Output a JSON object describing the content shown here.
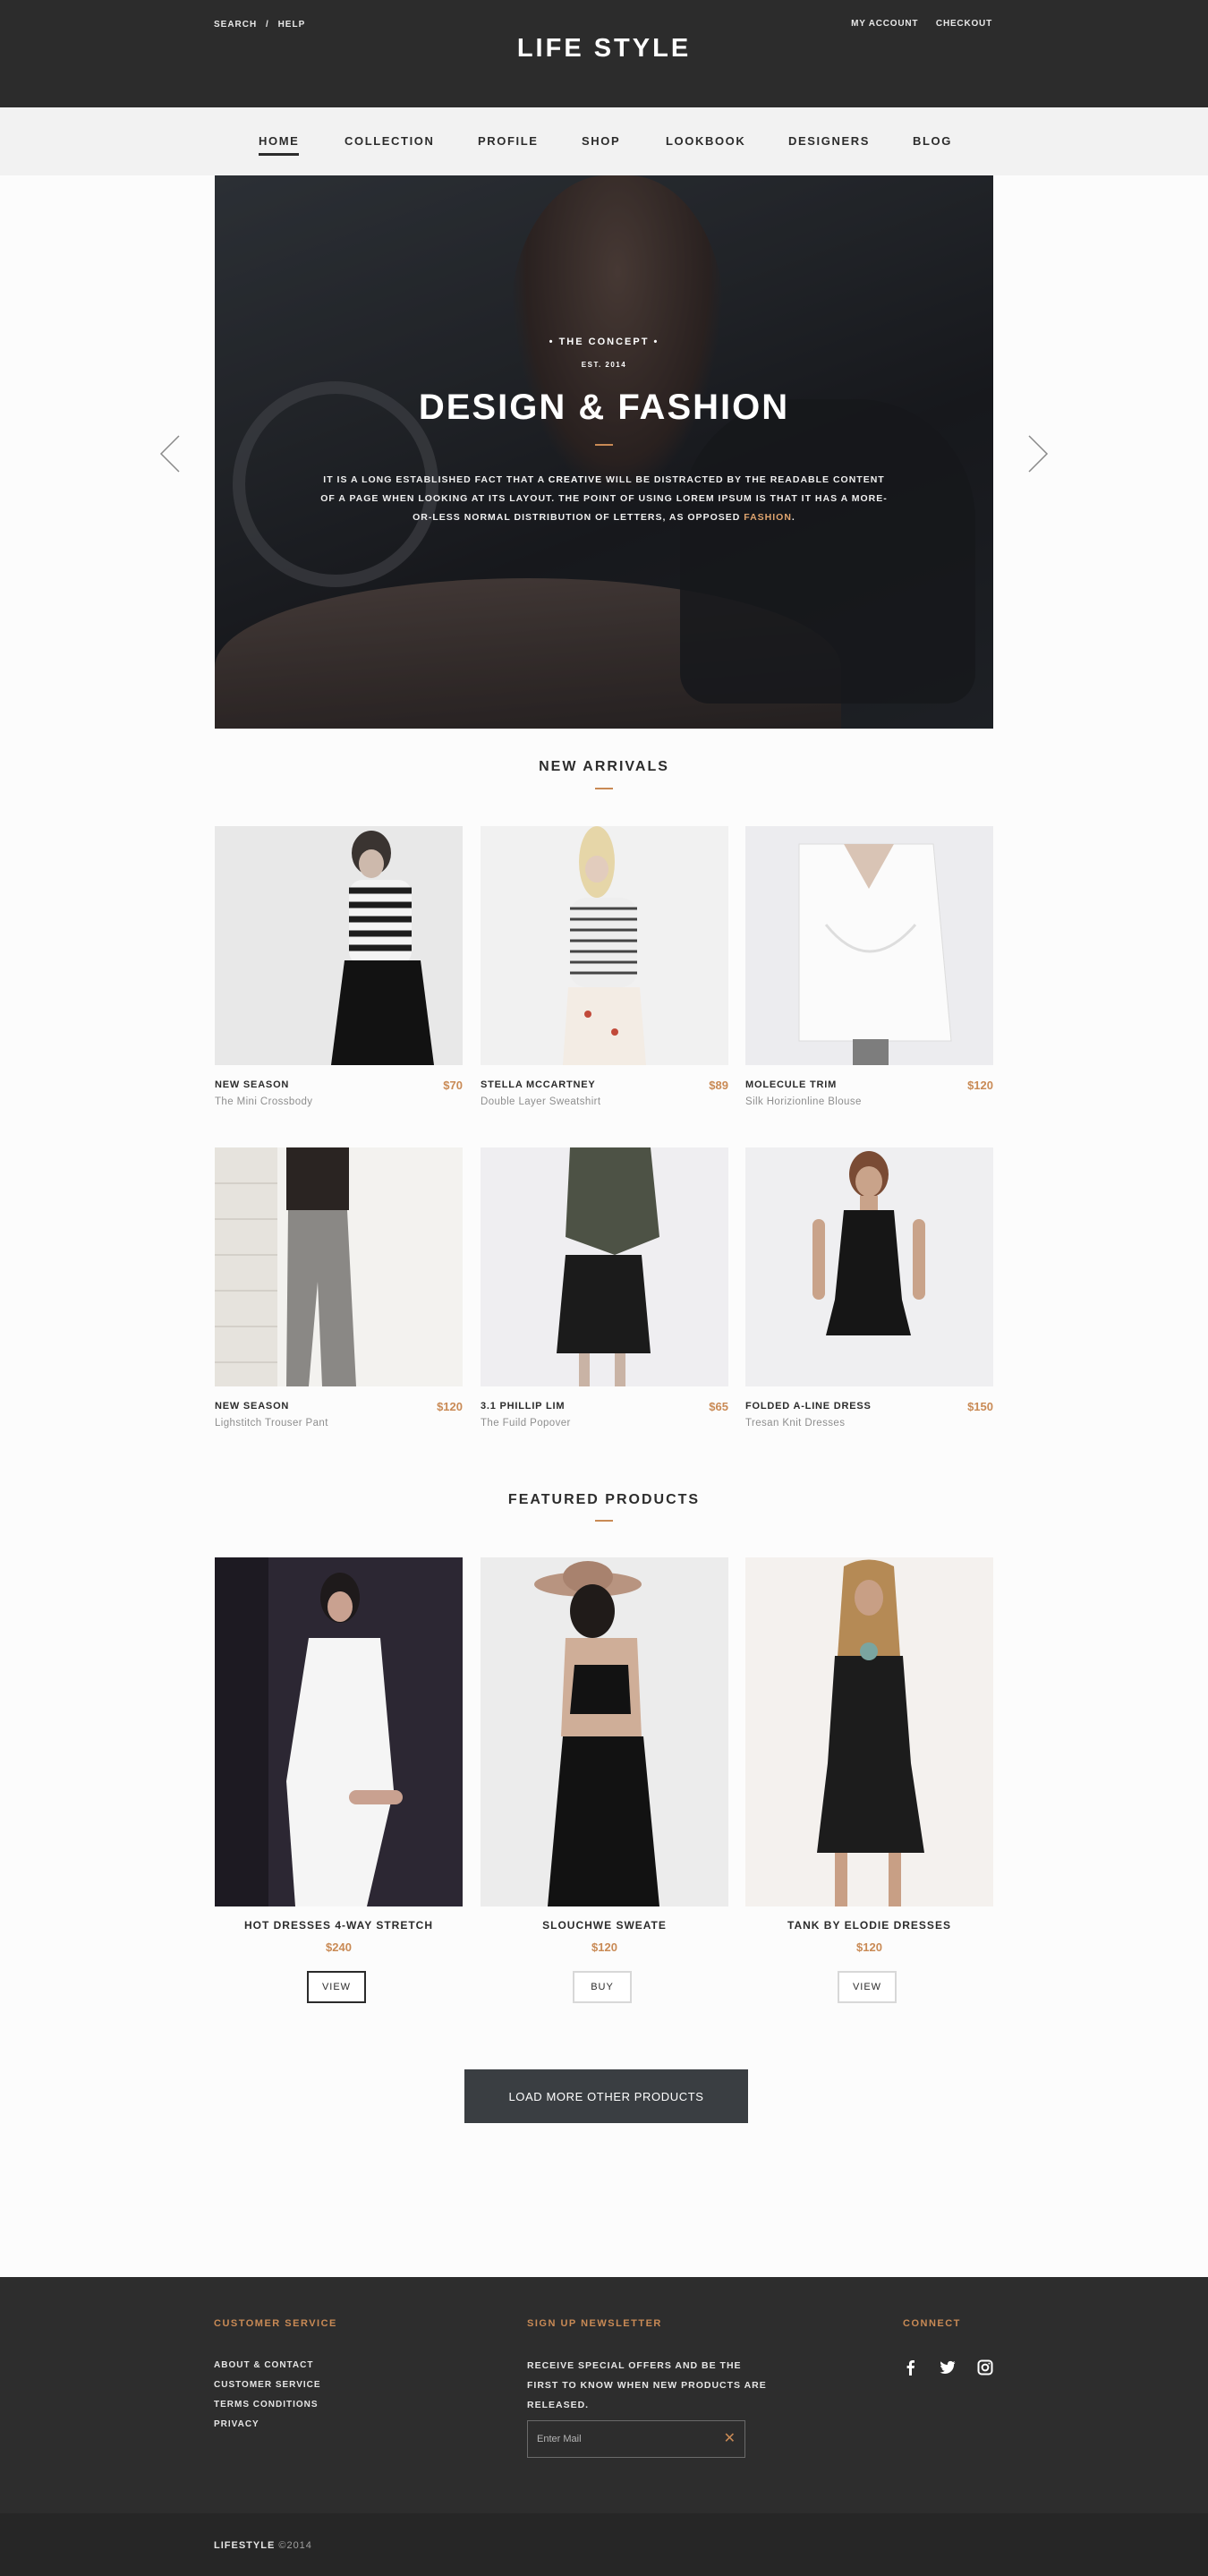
{
  "topbar": {
    "search": "SEARCH",
    "separator": "/",
    "help": "HELP",
    "my_account": "MY ACCOUNT",
    "checkout": "CHECKOUT",
    "logo": "LIFE STYLE"
  },
  "nav": {
    "items": [
      "HOME",
      "COLLECTION",
      "PROFILE",
      "SHOP",
      "LOOKBOOK",
      "DESIGNERS",
      "BLOG"
    ],
    "active": "HOME"
  },
  "hero": {
    "kicker": "• THE CONCEPT •",
    "est": "EST. 2014",
    "title": "DESIGN & FASHION",
    "text_1": "IT IS A LONG ESTABLISHED FACT THAT A ",
    "text_bold_1": "CREATIVE",
    "text_2": " WILL BE DISTRACTED BY THE READABLE CONTENT OF A PAGE WHEN LOOKING AT ITS LAYOUT. THE POINT OF USING LOREM IPSUM IS THAT IT HAS A MORE-OR-LESS NORMAL DISTRIBUTION OF LETTERS, AS OPPOSED ",
    "text_highlight": "FASHION",
    "text_end": "."
  },
  "new_arrivals": {
    "title": "NEW ARRIVALS",
    "products": [
      {
        "name": "NEW SEASON",
        "subtitle": "The Mini Crossbody",
        "price": "$70"
      },
      {
        "name": "STELLA MCCARTNEY",
        "subtitle": "Double Layer Sweatshirt",
        "price": "$89"
      },
      {
        "name": "MOLECULE TRIM",
        "subtitle": "Silk Horizionline Blouse",
        "price": "$120"
      },
      {
        "name": "NEW SEASON",
        "subtitle": "Lighstitch Trouser Pant",
        "price": "$120"
      },
      {
        "name": "3.1 PHILLIP LIM",
        "subtitle": "The Fuild Popover",
        "price": "$65"
      },
      {
        "name": "FOLDED A-LINE DRESS",
        "subtitle": "Tresan Knit Dresses",
        "price": "$150"
      }
    ]
  },
  "featured": {
    "title": "FEATURED PRODUCTS",
    "products": [
      {
        "name": "HOT DRESSES 4-WAY STRETCH",
        "price": "$240",
        "button": "VIEW"
      },
      {
        "name": "SLOUCHWE SWEATE",
        "price": "$120",
        "button": "BUY"
      },
      {
        "name": "TANK BY ELODIE DRESSES",
        "price": "$120",
        "button": "VIEW"
      }
    ],
    "load_more": "LOAD MORE OTHER PRODUCTS"
  },
  "footer": {
    "customer_service_title": "CUSTOMER SERVICE",
    "links": [
      "ABOUT & CONTACT",
      "CUSTOMER SERVICE",
      "TERMS CONDITIONS",
      "PRIVACY"
    ],
    "newsletter_title": "SIGN UP NEWSLETTER",
    "newsletter_text": "RECEIVE SPECIAL OFFERS AND BE THE FIRST TO KNOW WHEN NEW PRODUCTS ARE RELEASED.",
    "newsletter_placeholder": "Enter Mail",
    "newsletter_icon": "close-icon",
    "connect_title": "CONNECT",
    "social": [
      "facebook-icon",
      "twitter-icon",
      "instagram-icon"
    ],
    "copyright_brand": "LIFESTYLE",
    "copyright_year": "©2014"
  },
  "colors": {
    "accent": "#c98a55",
    "dark": "#2c2c2c",
    "nav_bg": "#f2f2f2"
  }
}
